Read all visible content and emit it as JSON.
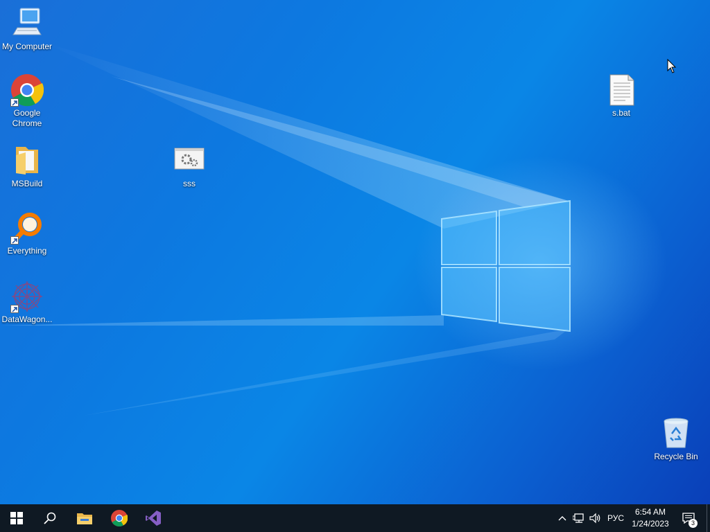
{
  "desktop": {
    "icons": [
      {
        "label": "My Computer",
        "icon": "computer-icon"
      },
      {
        "label": "Google Chrome",
        "icon": "chrome-icon",
        "shortcut": true
      },
      {
        "label": "MSBuild",
        "icon": "folder-icon"
      },
      {
        "label": "Everything",
        "icon": "everything-search-icon",
        "shortcut": true
      },
      {
        "label": "DataWagon...",
        "icon": "datawagon-icon",
        "shortcut": true
      },
      {
        "label": "sss",
        "icon": "settings-window-icon"
      },
      {
        "label": "s.bat",
        "icon": "batch-file-icon"
      },
      {
        "label": "Recycle Bin",
        "icon": "recycle-bin-icon"
      }
    ]
  },
  "taskbar": {
    "start": "windows-start-icon",
    "search": "search-icon",
    "pinned": [
      "file-explorer-icon",
      "chrome-icon",
      "visual-studio-icon"
    ],
    "tray": {
      "overflow": "chevron-up-icon",
      "network": "network-icon",
      "volume": "speaker-icon",
      "language": "РУС",
      "time": "6:54 AM",
      "date": "1/24/2023",
      "notifications": "action-center-icon",
      "notification_count": "3"
    }
  },
  "colors": {
    "desktop_blue": "#0a86e6",
    "taskbar": "#0f1923",
    "chrome_red": "#db4437",
    "chrome_yellow": "#f4c20d",
    "chrome_green": "#0f9d58",
    "chrome_blue": "#4285f4",
    "vs_purple": "#865fc5",
    "everything_orange": "#f57c00"
  }
}
